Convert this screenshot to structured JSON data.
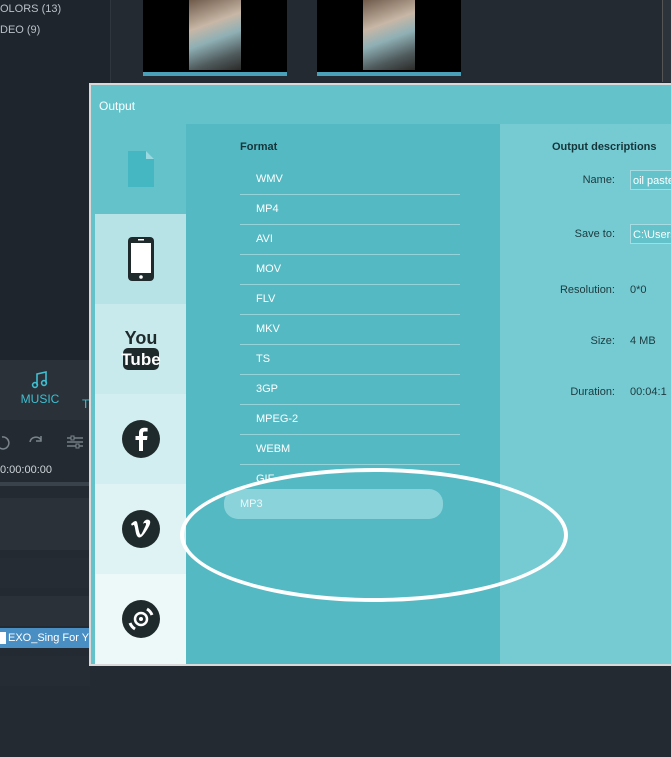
{
  "media_library": {
    "items": [
      {
        "label": "OLORS (13)"
      },
      {
        "label": "DEO (9)"
      }
    ]
  },
  "editor": {
    "music_tab_label": "MUSIC",
    "next_tab_partial": "T",
    "timecode": "0:00:00:00",
    "clip_label": "EXO_Sing For Y"
  },
  "dialog": {
    "title": "Output",
    "sidebar": [
      {
        "icon": "file-icon",
        "active": true
      },
      {
        "icon": "phone-icon"
      },
      {
        "icon": "youtube-icon"
      },
      {
        "icon": "facebook-icon"
      },
      {
        "icon": "vimeo-icon"
      },
      {
        "icon": "disc-icon"
      }
    ],
    "format": {
      "heading": "Format",
      "items": [
        "WMV",
        "MP4",
        "AVI",
        "MOV",
        "FLV",
        "MKV",
        "TS",
        "3GP",
        "MPEG-2",
        "WEBM",
        "GIF",
        "MP3"
      ],
      "selected": "MP3"
    },
    "description": {
      "heading": "Output descriptions",
      "name_label": "Name:",
      "name_value": "oil pastel",
      "save_label": "Save to:",
      "save_value": "C:\\Users",
      "resolution_label": "Resolution:",
      "resolution_value": "0*0",
      "size_label": "Size:",
      "size_value": "4 MB",
      "duration_label": "Duration:",
      "duration_value": "00:04:1"
    }
  },
  "colors": {
    "dialog_bg": "#63c2ca",
    "format_panel": "#55b9c3",
    "desc_panel": "#76cbd3",
    "sidebar_light": "#c3e7ea",
    "accent": "#3fbfd0"
  }
}
